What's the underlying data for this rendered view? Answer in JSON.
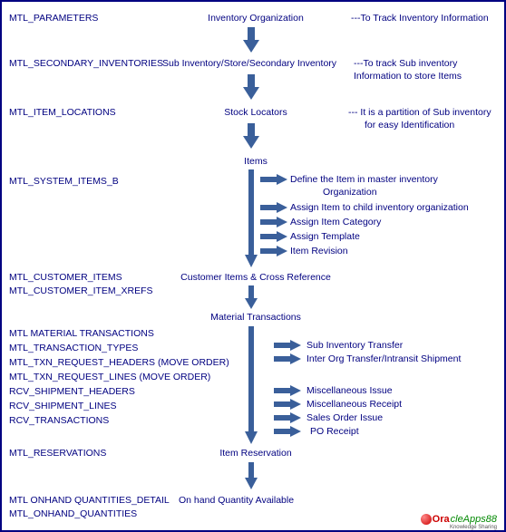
{
  "rows": [
    {
      "table": "MTL_PARAMETERS",
      "entity": "Inventory Organization",
      "desc": "---To Track Inventory Information"
    },
    {
      "table": "MTL_SECONDARY_INVENTORIES",
      "entity": "Sub Inventory/Store/Secondary Inventory",
      "desc": "---To track Sub inventory",
      "desc2": "Information to store Items"
    },
    {
      "table": "MTL_ITEM_LOCATIONS",
      "entity": "Stock Locators",
      "desc": "--- It is a partition of Sub inventory",
      "desc2": "for easy Identification"
    },
    {
      "table": "MTL_SYSTEM_ITEMS_B",
      "entity": "Items"
    },
    {
      "table": "MTL_CUSTOMER_ITEMS",
      "table2": "MTL_CUSTOMER_ITEM_XREFS",
      "entity": "Customer Items & Cross Reference"
    },
    {
      "entity": "Material Transactions"
    },
    {
      "table": "MTL_RESERVATIONS",
      "entity": "Item Reservation"
    },
    {
      "table": "MTL ONHAND QUANTITIES_DETAIL",
      "table2": "MTL_ONHAND_QUANTITIES",
      "entity": "On hand Quantity Available"
    }
  ],
  "item_sub": [
    "Define the Item in master inventory",
    "Organization",
    "Assign Item to child inventory organization",
    "Assign Item Category",
    "Assign Template",
    "Item Revision"
  ],
  "mt_tables": [
    "MTL MATERIAL TRANSACTIONS",
    "MTL_TRANSACTION_TYPES",
    "MTL_TXN_REQUEST_HEADERS  (MOVE ORDER)",
    "MTL_TXN_REQUEST_LINES (MOVE ORDER)",
    "RCV_SHIPMENT_HEADERS",
    "RCV_SHIPMENT_LINES",
    "RCV_TRANSACTIONS"
  ],
  "mt_sub_a": [
    "Sub Inventory Transfer",
    "Inter Org Transfer/Intransit Shipment"
  ],
  "mt_sub_b": [
    "Miscellaneous Issue",
    "Miscellaneous Receipt",
    "Sales Order Issue",
    "PO Receipt"
  ],
  "logo": {
    "part1": "Ora",
    "part2": "cleApps88",
    "sub": "Knowledge Sharing"
  }
}
